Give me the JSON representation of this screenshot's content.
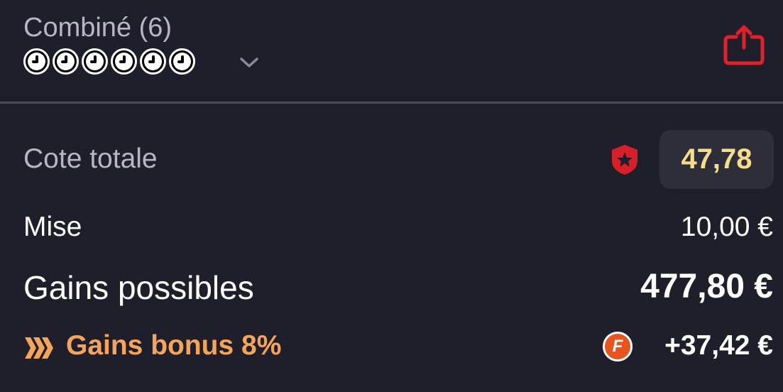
{
  "header": {
    "title": "Combiné (6)",
    "selection_icons": [
      "clock-icon",
      "clock-icon",
      "clock-icon",
      "clock-icon",
      "clock-icon",
      "clock-icon"
    ],
    "expand_icon": "chevron-down-icon",
    "share_icon": "share-icon"
  },
  "summary": {
    "cote_label": "Cote totale",
    "cote_value": "47,78",
    "boost_icon": "shield-star-icon",
    "mise_label": "Mise",
    "mise_value": "10,00 €",
    "gains_label": "Gains possibles",
    "gains_value": "477,80 €",
    "bonus_label": "Gains bonus 8%",
    "bonus_icon": "chevrons-right-icon",
    "bonus_badge": "F",
    "bonus_value": "+37,42 €"
  },
  "colors": {
    "background": "#1f1f2b",
    "accent_red": "#e0202a",
    "cote_text": "#f7dc8a",
    "bonus_orange": "#f4a55a",
    "badge_orange": "#e8531e",
    "muted_text": "#b8b6c6"
  }
}
